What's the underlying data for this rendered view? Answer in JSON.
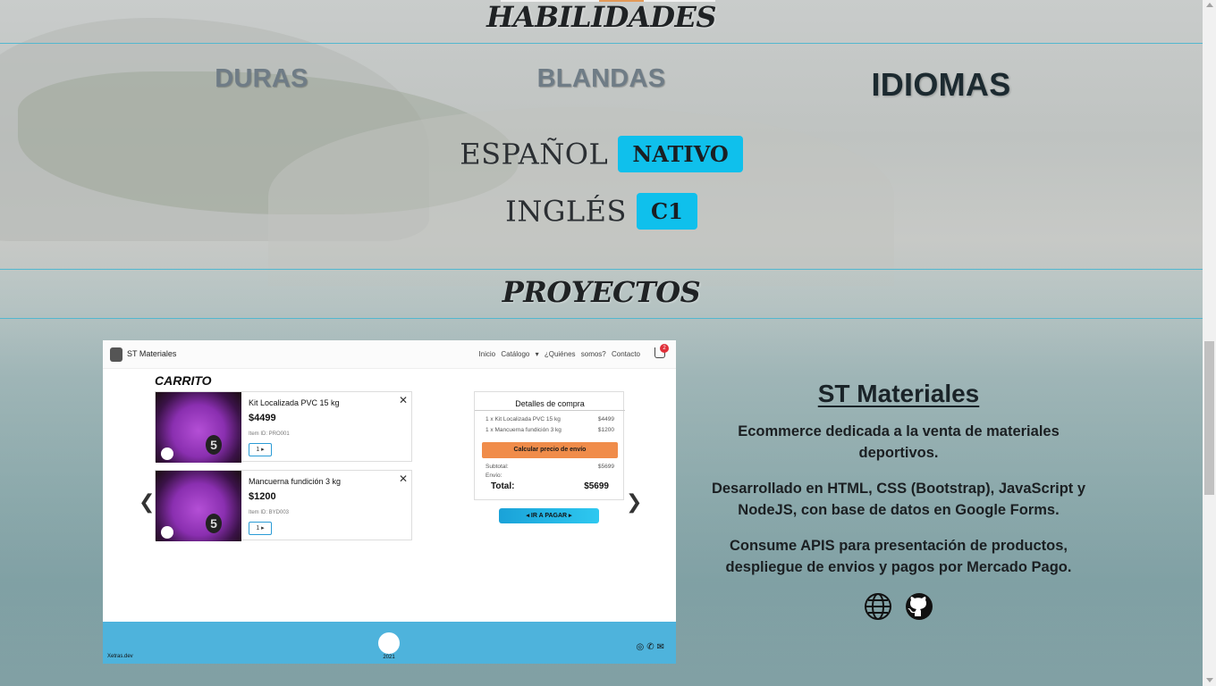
{
  "skills": {
    "section_title": "HABILIDADES",
    "tabs": [
      {
        "label": "DURAS",
        "active": false
      },
      {
        "label": "BLANDAS",
        "active": false
      },
      {
        "label": "IDIOMAS",
        "active": true
      }
    ],
    "languages": [
      {
        "name": "ESPAÑOL",
        "level": "NATIVO"
      },
      {
        "name": "INGLÉS",
        "level": "C1"
      }
    ],
    "badge_color": "#0fc0ec"
  },
  "projects": {
    "section_title": "PROYECTOS",
    "current": {
      "title": "ST Materiales",
      "description": [
        "Ecommerce dedicada a la venta de materiales deportivos.",
        "Desarrollado en HTML, CSS (Bootstrap), JavaScript y NodeJS, con base de datos en Google Forms.",
        "Consume APIS para presentación de productos, despliegue de envios y pagos por Mercado Pago."
      ],
      "icons": [
        "globe-icon",
        "github-icon"
      ]
    },
    "screenshot": {
      "brand": "ST Materiales",
      "nav_links": "Inicio  Catálogo ▾  ¿Quiénes somos?  Contacto",
      "cart_count": "2",
      "cart_title": "CARRITO",
      "items": [
        {
          "name": "Kit Localizada PVC 15 kg",
          "price": "$4499",
          "id": "Item ID: PRO001",
          "qty": "1 ▸"
        },
        {
          "name": "Mancuerna fundición 3 kg",
          "price": "$1200",
          "id": "Item ID: BYD003",
          "qty": "1 ▸"
        }
      ],
      "summary": {
        "title": "Detalles de compra",
        "lines": [
          {
            "label": "1 x Kit Localizada PVC 15 kg",
            "value": "$4499"
          },
          {
            "label": "1 x Mancuerna fundición 3 kg",
            "value": "$1200"
          }
        ],
        "ship_button": "Calcular precio de envío",
        "subtotal_label": "Subtotal:",
        "subtotal_value": "$5699",
        "shipping_label": "Envío:",
        "total_label": "Total:",
        "total_value": "$5699"
      },
      "pay_button": "◂ IR A PAGAR ▸",
      "footer_credit": "Xetras.dev",
      "footer_year": "2021"
    }
  },
  "colors": {
    "accent_line": "#53b7cf",
    "badge": "#0fc0ec",
    "footer": "#4eb3dc"
  }
}
